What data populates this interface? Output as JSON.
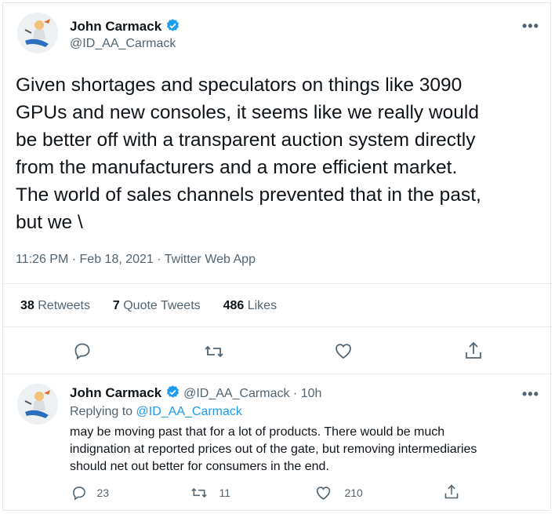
{
  "colors": {
    "accent": "#1d9bf0",
    "muted": "#536471",
    "text": "#0f1419"
  },
  "tweet": {
    "author_name": "John Carmack",
    "author_handle": "@ID_AA_Carmack",
    "more_icon": "more-icon",
    "text_lines": [
      "Given shortages and speculators on things like 3090",
      "GPUs and new consoles, it seems like we really would",
      "be better off with a transparent auction system directly",
      "from the manufacturers and a more efficient market.",
      "The world of sales channels prevented that in the past,",
      "but we \\"
    ],
    "time": "11:26 PM",
    "date": "Feb 18, 2021",
    "source": "Twitter Web App",
    "separator": "·",
    "retweets_count": "38",
    "retweets_label": "Retweets",
    "quotes_count": "7",
    "quotes_label": "Quote Tweets",
    "likes_count": "486",
    "likes_label": "Likes",
    "actions": [
      "reply-icon",
      "retweet-icon",
      "like-icon",
      "share-icon"
    ]
  },
  "reply": {
    "author_name": "John Carmack",
    "author_handle": "@ID_AA_Carmack",
    "time_ago": "10h",
    "separator": "·",
    "replying_label": "Replying to",
    "replying_handle": "@ID_AA_Carmack",
    "text_lines": [
      "may be moving past that for a lot of products. There would be much",
      "indignation at reported prices out of the gate, but removing intermediaries",
      "should net out better for consumers in the end."
    ],
    "reply_count": "23",
    "retweet_count": "11",
    "like_count": "210"
  }
}
